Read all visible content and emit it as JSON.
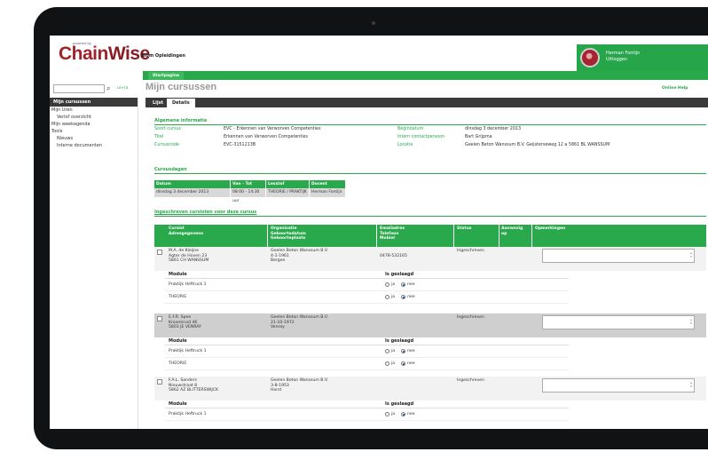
{
  "header": {
    "logo_tagline": "powered by",
    "logo_chain": "Chain",
    "logo_wise": "Wise",
    "app_name": "Blom Opleidingen",
    "user_name": "Herman Fontijn",
    "logout": "Uitloggen"
  },
  "nav": {
    "start_tab": "Startpagina"
  },
  "search": {
    "value": "",
    "advanced": "ui+ra",
    "icon": "search-binoculars-icon"
  },
  "page": {
    "title": "Mijn cursussen",
    "online_help": "Online Help"
  },
  "sidebar": {
    "heading": "Mijn cursussen",
    "items": [
      {
        "label": "Mijn Uren",
        "sub": false
      },
      {
        "label": "Verlof overzicht",
        "sub": true
      },
      {
        "label": "Mijn weekagenda",
        "sub": false
      },
      {
        "label": "Tools",
        "sub": false
      },
      {
        "label": "Nieuws",
        "sub": true
      },
      {
        "label": "Interne documenten",
        "sub": true
      }
    ]
  },
  "tabs": {
    "lijst": "Lijst",
    "details": "Details"
  },
  "general": {
    "title": "Algemene informatie",
    "soort_label": "Soort cursus",
    "soort_value": "EVC - Erkennen van Verworven Competenties",
    "titel_label": "Titel",
    "titel_value": "Erkennen van Verworven Competenties",
    "code_label": "Cursuscode",
    "code_value": "EVC-3151213B",
    "begin_label": "Begindatum",
    "begin_value": "dinsdag 3 december 2013",
    "contact_label": "Intern contactpersoon",
    "contact_value": "Bart Grijpma",
    "locatie_label": "Locatie",
    "locatie_value": "Geelen Beton Wanssum B.V. Geijsterseweg 12 a 5861 BL WANSSUM"
  },
  "course_days": {
    "title": "Cursusdagen",
    "headers": [
      "Datum",
      "Van - Tot",
      "Lesstof",
      "Docent"
    ],
    "row": [
      "dinsdag 3 december 2013",
      "08:00 - 14:30 uur",
      "THEORIE / PRAKTIJK",
      "Herman Fontijn"
    ]
  },
  "students": {
    "title": "Ingeschreven cursisten voor deze cursus",
    "headers": {
      "cursist": "Cursist",
      "adres": "Adresgegevens",
      "org": "Organisatie",
      "gebdatum": "Geboortedatum",
      "gebplaats": "Geboorteplaats",
      "email": "Emailadres",
      "telefoon": "Telefoon",
      "mobiel": "Mobiel",
      "status": "Status",
      "aanwezig1": "Aanwezig",
      "aanwezig2": "op",
      "opm": "Opmerkingen"
    },
    "module_header": "Module",
    "passed_header": "Is geslaagd",
    "yes": "ja",
    "no": "nee",
    "rows": [
      {
        "name": "M.A. de Kleijne",
        "street": "Agter de Hoven 23",
        "city": "5861 CH WANSSUM",
        "org": "Geelen Beton Wanssum B.V.",
        "birthdate": "4-1-1961",
        "birthplace": "Bergen",
        "phone": "0478-532165",
        "status": "Ingeschreven",
        "modules": [
          "Praktijk Heftruck 1",
          "THEORIE"
        ]
      },
      {
        "name": "E.F.R. Spee",
        "street": "Kroonkruid 46",
        "city": "5803 JE VENRAY",
        "org": "Geelen Beton Wanssum B.V.",
        "birthdate": "21-10-1972",
        "birthplace": "Venray",
        "phone": "",
        "status": "Ingeschreven",
        "modules": [
          "Praktijk Heftruck 1",
          "THEORIE"
        ]
      },
      {
        "name": "F.A.L. Sanders",
        "street": "Nieuwstraat 8",
        "city": "5862 AZ BLITTERSWIJCK",
        "org": "Geelen Beton Wanssum B.V.",
        "birthdate": "3-8-1953",
        "birthplace": "Horst",
        "phone": "",
        "status": "Ingeschreven",
        "modules": [
          "Praktijk Heftruck 1"
        ]
      }
    ]
  }
}
